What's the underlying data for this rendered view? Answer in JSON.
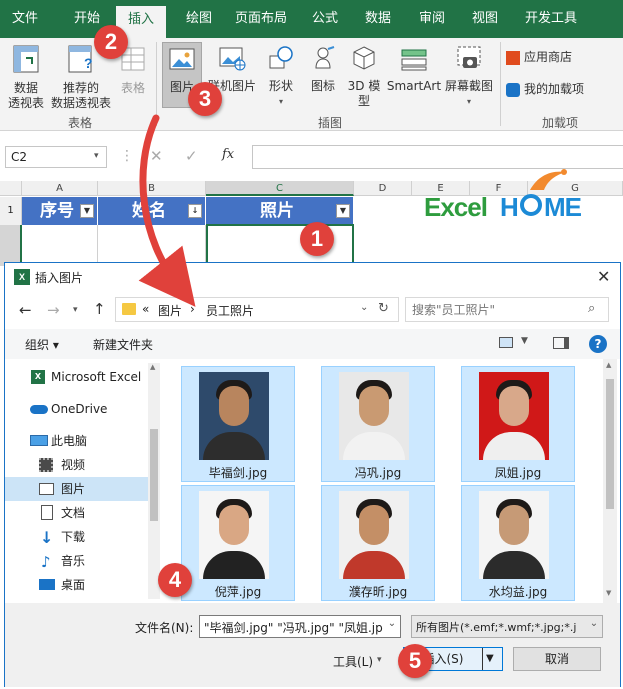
{
  "ribbon": {
    "tabs": [
      "文件",
      "开始",
      "插入",
      "绘图",
      "页面布局",
      "公式",
      "数据",
      "审阅",
      "视图",
      "开发工具"
    ],
    "active_tab": "插入",
    "tables_group": {
      "pivot_line1": "数据",
      "pivot_line2": "透视表",
      "rec_line1": "推荐的",
      "rec_line2": "数据透视表",
      "table": "表格",
      "group_label": "表格"
    },
    "illus_group": {
      "picture": "图片",
      "online_picture": "联机图片",
      "shapes": "形状",
      "icons": "图标",
      "model_line1": "3D 模",
      "model_line2": "型",
      "smartart": "SmartArt",
      "screenshot_line1": "屏幕截图",
      "group_label": "插图"
    },
    "addins_group": {
      "store": "应用商店",
      "my_addins": "我的加载项",
      "group_label": "加载项"
    }
  },
  "formula_bar": {
    "name_box": "C2",
    "fx": "fx"
  },
  "sheet": {
    "columns": [
      "A",
      "B",
      "C",
      "D",
      "E",
      "F",
      "G"
    ],
    "row_numbers": [
      "1"
    ],
    "headers": [
      "序号",
      "姓名",
      "照片"
    ],
    "logo_text_1": "Excel",
    "logo_text_2": "H",
    "logo_text_3": "ME"
  },
  "dialog": {
    "title": "插入图片",
    "breadcrumb": {
      "prefix": "«",
      "root": "图片",
      "sep": "›",
      "current": "员工照片"
    },
    "search_placeholder": "搜索\"员工照片\"",
    "toolbar": {
      "organize": "组织 ▾",
      "new_folder": "新建文件夹"
    },
    "sidebar": [
      {
        "label": "Microsoft Excel",
        "icon": "excel-icon"
      },
      {
        "label": "OneDrive",
        "icon": "cloud-icon"
      },
      {
        "label": "此电脑",
        "icon": "computer-icon"
      },
      {
        "label": "视频",
        "icon": "video-icon"
      },
      {
        "label": "图片",
        "icon": "pictures-icon"
      },
      {
        "label": "文档",
        "icon": "document-icon"
      },
      {
        "label": "下载",
        "icon": "download-icon"
      },
      {
        "label": "音乐",
        "icon": "music-icon"
      },
      {
        "label": "桌面",
        "icon": "desktop-icon"
      }
    ],
    "files": [
      {
        "name": "毕福剑.jpg",
        "bg": "#2e4a6b",
        "face": "#b8855e",
        "shirt": "#2d2d2d"
      },
      {
        "name": "冯巩.jpg",
        "bg": "#e8e8e8",
        "face": "#c99a72",
        "shirt": "#f2f2f2"
      },
      {
        "name": "凤姐.jpg",
        "bg": "#d01818",
        "face": "#d8a88a",
        "shirt": "#efefef"
      },
      {
        "name": "倪萍.jpg",
        "bg": "#f5f5f5",
        "face": "#d9a784",
        "shirt": "#222"
      },
      {
        "name": "濮存昕.jpg",
        "bg": "#f0f0f0",
        "face": "#c48f66",
        "shirt": "#c0392b"
      },
      {
        "name": "水均益.jpg",
        "bg": "#f4f4f4",
        "face": "#c69a76",
        "shirt": "#2b2b2b"
      }
    ],
    "filename_label": "文件名(N):",
    "filename_value": "\"毕福剑.jpg\" \"冯巩.jpg\" \"凤姐.jp",
    "filetype_value": "所有图片(*.emf;*.wmf;*.jpg;*.j",
    "tools_label": "工具(L)",
    "insert_label": "插入(S)",
    "cancel_label": "取消"
  },
  "badges": [
    "1",
    "2",
    "3",
    "4",
    "5"
  ],
  "colors": {
    "excel_green": "#217346",
    "header_blue": "#4472c4",
    "badge_red": "#e0413b",
    "select_blue": "#cce8ff"
  }
}
